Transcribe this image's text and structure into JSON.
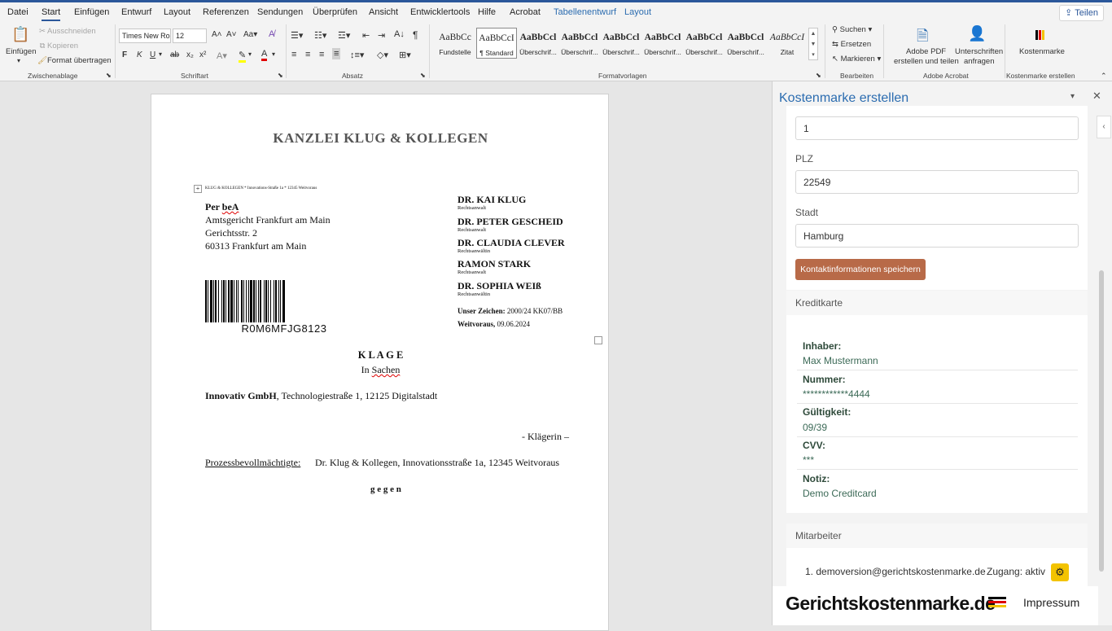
{
  "tabs": [
    "Datei",
    "Start",
    "Einfügen",
    "Entwurf",
    "Layout",
    "Referenzen",
    "Sendungen",
    "Überprüfen",
    "Ansicht",
    "Entwicklertools",
    "Hilfe",
    "Acrobat",
    "Tabellenentwurf",
    "Layout"
  ],
  "share_label": "Teilen",
  "ribbon": {
    "clipboard": {
      "paste": "Einfügen",
      "cut": "Ausschneiden",
      "copy": "Kopieren",
      "format_painter": "Format übertragen",
      "group": "Zwischenablage"
    },
    "font": {
      "name": "Times New Ro",
      "size": "12",
      "group": "Schriftart",
      "bold": "F",
      "italic": "K",
      "underline": "U",
      "strike": "ab",
      "sub": "x₂",
      "sup": "x²"
    },
    "paragraph": {
      "group": "Absatz"
    },
    "styles": {
      "group": "Formatvorlagen",
      "items": [
        {
          "sample": "AaBbCc",
          "name": "Fundstelle"
        },
        {
          "sample": "AaBbCcI",
          "name": "¶ Standard"
        },
        {
          "sample": "AaBbCcl",
          "name": "Überschrif..."
        },
        {
          "sample": "AaBbCcl",
          "name": "Überschrif..."
        },
        {
          "sample": "AaBbCcl",
          "name": "Überschrif..."
        },
        {
          "sample": "AaBbCcl",
          "name": "Überschrif..."
        },
        {
          "sample": "AaBbCcl",
          "name": "Überschrif..."
        },
        {
          "sample": "AaBbCcl",
          "name": "Überschrif..."
        },
        {
          "sample": "AaBbCcI",
          "name": "Zitat"
        }
      ]
    },
    "editing": {
      "find": "Suchen",
      "replace": "Ersetzen",
      "select": "Markieren",
      "group": "Bearbeiten"
    },
    "acrobat": {
      "pdf": "Adobe PDF",
      "pdf2": "erstellen und teilen",
      "sign": "Unterschriften",
      "sign2": "anfragen",
      "group": "Adobe Acrobat"
    },
    "kosten": {
      "label": "Kostenmarke",
      "group": "Kostenmarke erstellen"
    }
  },
  "doc": {
    "header": "KANZLEI KLUG & KOLLEGEN",
    "sender_line": "KLUG & KOLLEGEN * Innovations-Straße 1a * 12345 Weitvoraus",
    "recipient": {
      "via_prefix": "Per ",
      "via": "beA",
      "line1": "Amtsgericht Frankfurt am Main",
      "line2": "Gerichtsstr. 2",
      "line3": "60313 Frankfurt am Main"
    },
    "barcode": "R0M6MFJG8123",
    "lawyers": [
      {
        "name": "DR. KAI KLUG",
        "title": "Rechtsanwalt"
      },
      {
        "name": "DR. PETER GESCHEID",
        "title": "Rechtsanwalt"
      },
      {
        "name": "DR. CLAUDIA CLEVER",
        "title": "Rechtsanwältin"
      },
      {
        "name": "RAMON STARK",
        "title": "Rechtsanwalt"
      },
      {
        "name": "DR. SOPHIA WEIß",
        "title": "Rechtsanwältin"
      }
    ],
    "reference_label": "Unser Zeichen:",
    "reference": "2000/24 KK07/BB",
    "place_label": "Weitvoraus,",
    "date": "09.06.2024",
    "heading": "K L A G E",
    "subheading_prefix": "In ",
    "subheading": "Sachen",
    "party_name": "Innovativ GmbH",
    "party_address": ", Technologiestraße 1, 12125 Digitalstadt",
    "party_role": "- Klägerin –",
    "counsel_label": "Prozessbevollmächtigte:",
    "counsel": "Dr. Klug & Kollegen, Innovationsstraße 1a, 12345 Weitvoraus",
    "against": "g e g e n"
  },
  "pane": {
    "title": "Kostenmarke erstellen",
    "field_top_value": "1",
    "plz_label": "PLZ",
    "plz_value": "22549",
    "city_label": "Stadt",
    "city_value": "Hamburg",
    "save_button": "Kontaktinformationen speichern",
    "card_section": "Kreditkarte",
    "card": [
      {
        "label": "Inhaber:",
        "value": "Max Mustermann"
      },
      {
        "label": "Nummer:",
        "value": "************4444"
      },
      {
        "label": "Gültigkeit:",
        "value": "09/39"
      },
      {
        "label": "CVV:",
        "value": "***"
      },
      {
        "label": "Notiz:",
        "value": "Demo Creditcard"
      }
    ],
    "staff_section": "Mitarbeiter",
    "staff_entry": "1. demoversion@gerichtskostenmarke.de",
    "staff_access": "Zugang: aktiv",
    "brand": "Gerichtskostenmarke.de",
    "impressum": "Impressum"
  },
  "colors": {
    "accent": "#2b579a",
    "save_button": "#b86a48",
    "gear": "#f3c300"
  }
}
